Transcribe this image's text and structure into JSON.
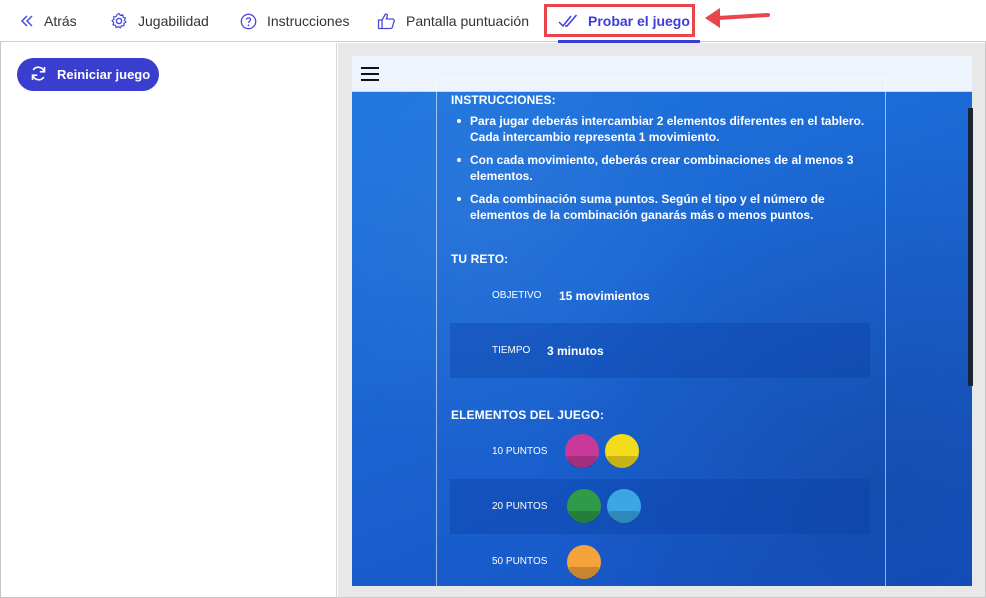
{
  "tabs": [
    {
      "label": "Atrás",
      "icon": "double-chevron-left-icon"
    },
    {
      "label": "Jugabilidad",
      "icon": "gear-icon"
    },
    {
      "label": "Instrucciones",
      "icon": "question-circle-icon"
    },
    {
      "label": "Pantalla puntuación",
      "icon": "thumbs-up-icon"
    },
    {
      "label": "Probar el juego",
      "icon": "double-check-icon",
      "active": true
    }
  ],
  "left_panel": {
    "restart_label": "Reiniciar juego"
  },
  "game": {
    "instructions_title": "INSTRUCCIONES:",
    "instructions": [
      "Para jugar deberás intercambiar 2 elementos diferentes en el tablero. Cada intercambio representa 1 movimiento.",
      "Con cada movimiento, deberás crear combinaciones de al menos 3 elementos.",
      "Cada combinación suma puntos. Según el tipo y el número de elementos de la combinación ganarás más o menos puntos."
    ],
    "challenge_title": "TU RETO:",
    "objective_label": "OBJETIVO",
    "objective_value": "15 movimientos",
    "time_label": "TIEMPO",
    "time_value": "3 minutos",
    "elements_title": "ELEMENTOS DEL JUEGO:",
    "elements": [
      {
        "points": "10 PUNTOS",
        "gems": [
          "#c8399a",
          "#f2dc1c"
        ]
      },
      {
        "points": "20 PUNTOS",
        "gems": [
          "#2f9a48",
          "#3aa6e3"
        ]
      },
      {
        "points": "50 PUNTOS",
        "gems": [
          "#f5a43c"
        ]
      }
    ]
  },
  "colors": {
    "accent": "#3d3dd6",
    "highlight": "#e8454d",
    "game_background": "#1e6fd6"
  }
}
